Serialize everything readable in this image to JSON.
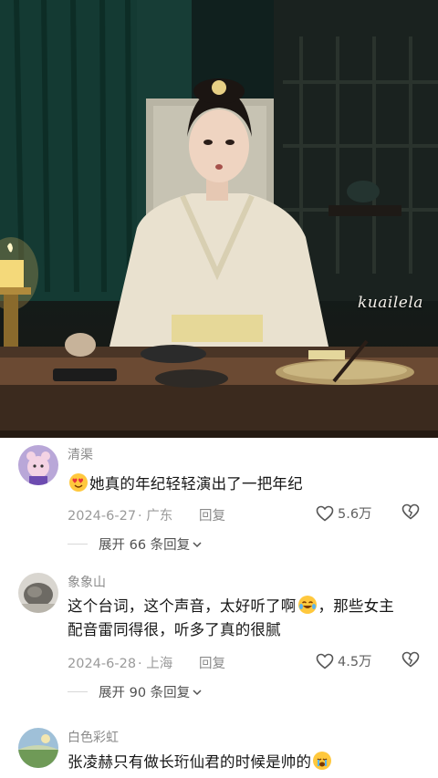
{
  "video": {
    "watermark": "kuailela"
  },
  "comments": [
    {
      "username": "清渠",
      "emoji": "heart-eyes",
      "text": "她真的年纪轻轻演出了一把年纪",
      "date": "2024-6-27",
      "location": "广东",
      "reply_label": "回复",
      "likes": "5.6万",
      "expand_label": "展开 66 条回复"
    },
    {
      "username": "象象山",
      "text_line1_part1": "这个台词，这个声音，太好听了啊",
      "emoji": "crying-laughing",
      "text_line1_part2": "，那些女主",
      "text_line2": "配音雷同得很，听多了真的很腻",
      "date": "2024-6-28",
      "location": "上海",
      "reply_label": "回复",
      "likes": "4.5万",
      "expand_label": "展开 90 条回复"
    },
    {
      "username": "白色彩虹",
      "text": "张凌赫只有做长珩仙君的时候是帅的",
      "emoji": "sad-crying"
    }
  ],
  "colors": {
    "username": "#8a8a8a",
    "text": "#161616",
    "meta": "#9a9a9a",
    "emoji": "#ffc83d"
  }
}
